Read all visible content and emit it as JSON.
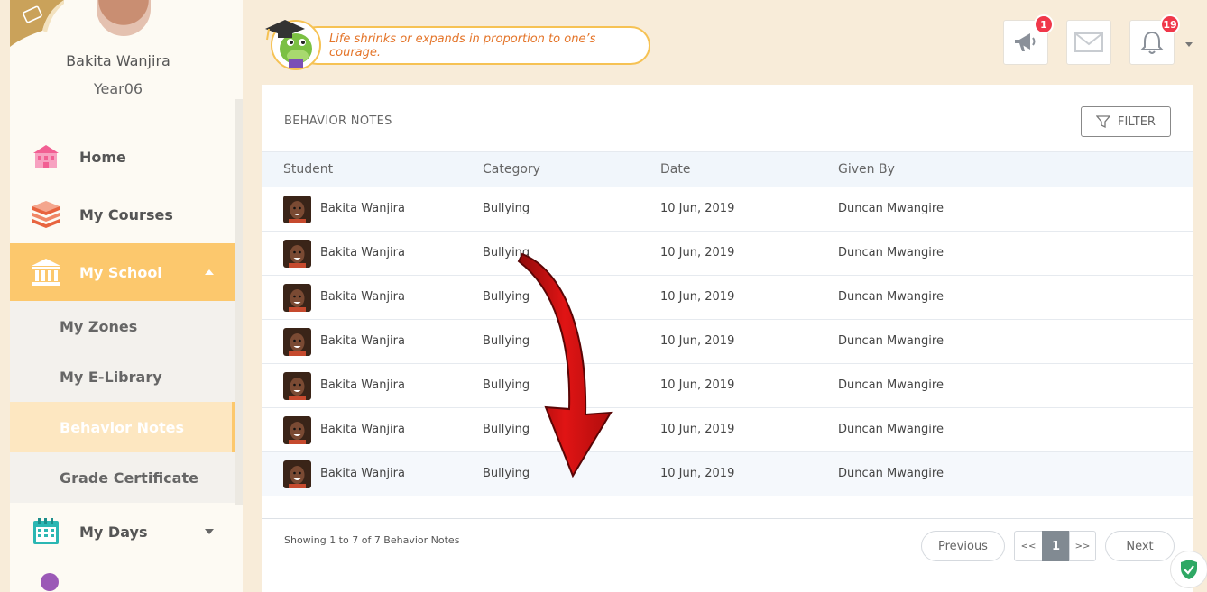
{
  "profile": {
    "name": "Bakita Wanjira",
    "year": "Year06"
  },
  "nav": {
    "home": "Home",
    "courses": "My Courses",
    "school": "My School",
    "zones": "My Zones",
    "elibrary": "My E-Library",
    "behavior": "Behavior Notes",
    "certificate": "Grade Certificate",
    "days": "My Days"
  },
  "header": {
    "quote": "Life shrinks or expands in proportion to one’s courage.",
    "announcements_badge": "1",
    "notifications_badge": "19"
  },
  "card": {
    "title": "BEHAVIOR NOTES",
    "filter_label": "FILTER",
    "columns": [
      "Student",
      "Category",
      "Date",
      "Given By"
    ],
    "rows": [
      {
        "student": "Bakita Wanjira",
        "category": "Bullying",
        "date": "10 Jun, 2019",
        "given_by": "Duncan Mwangire"
      },
      {
        "student": "Bakita Wanjira",
        "category": "Bullying",
        "date": "10 Jun, 2019",
        "given_by": "Duncan Mwangire"
      },
      {
        "student": "Bakita Wanjira",
        "category": "Bullying",
        "date": "10 Jun, 2019",
        "given_by": "Duncan Mwangire"
      },
      {
        "student": "Bakita Wanjira",
        "category": "Bullying",
        "date": "10 Jun, 2019",
        "given_by": "Duncan Mwangire"
      },
      {
        "student": "Bakita Wanjira",
        "category": "Bullying",
        "date": "10 Jun, 2019",
        "given_by": "Duncan Mwangire"
      },
      {
        "student": "Bakita Wanjira",
        "category": "Bullying",
        "date": "10 Jun, 2019",
        "given_by": "Duncan Mwangire"
      },
      {
        "student": "Bakita Wanjira",
        "category": "Bullying",
        "date": "10 Jun, 2019",
        "given_by": "Duncan Mwangire"
      }
    ],
    "showing": "Showing 1 to 7 of 7 Behavior Notes",
    "pagination": {
      "previous": "Previous",
      "first": "<<",
      "current": "1",
      "last": ">>",
      "next": "Next"
    }
  },
  "colors": {
    "accent": "#fcc86d",
    "badge": "#f0374a",
    "quote": "#e4752a",
    "arrow": "#d40d0d"
  }
}
